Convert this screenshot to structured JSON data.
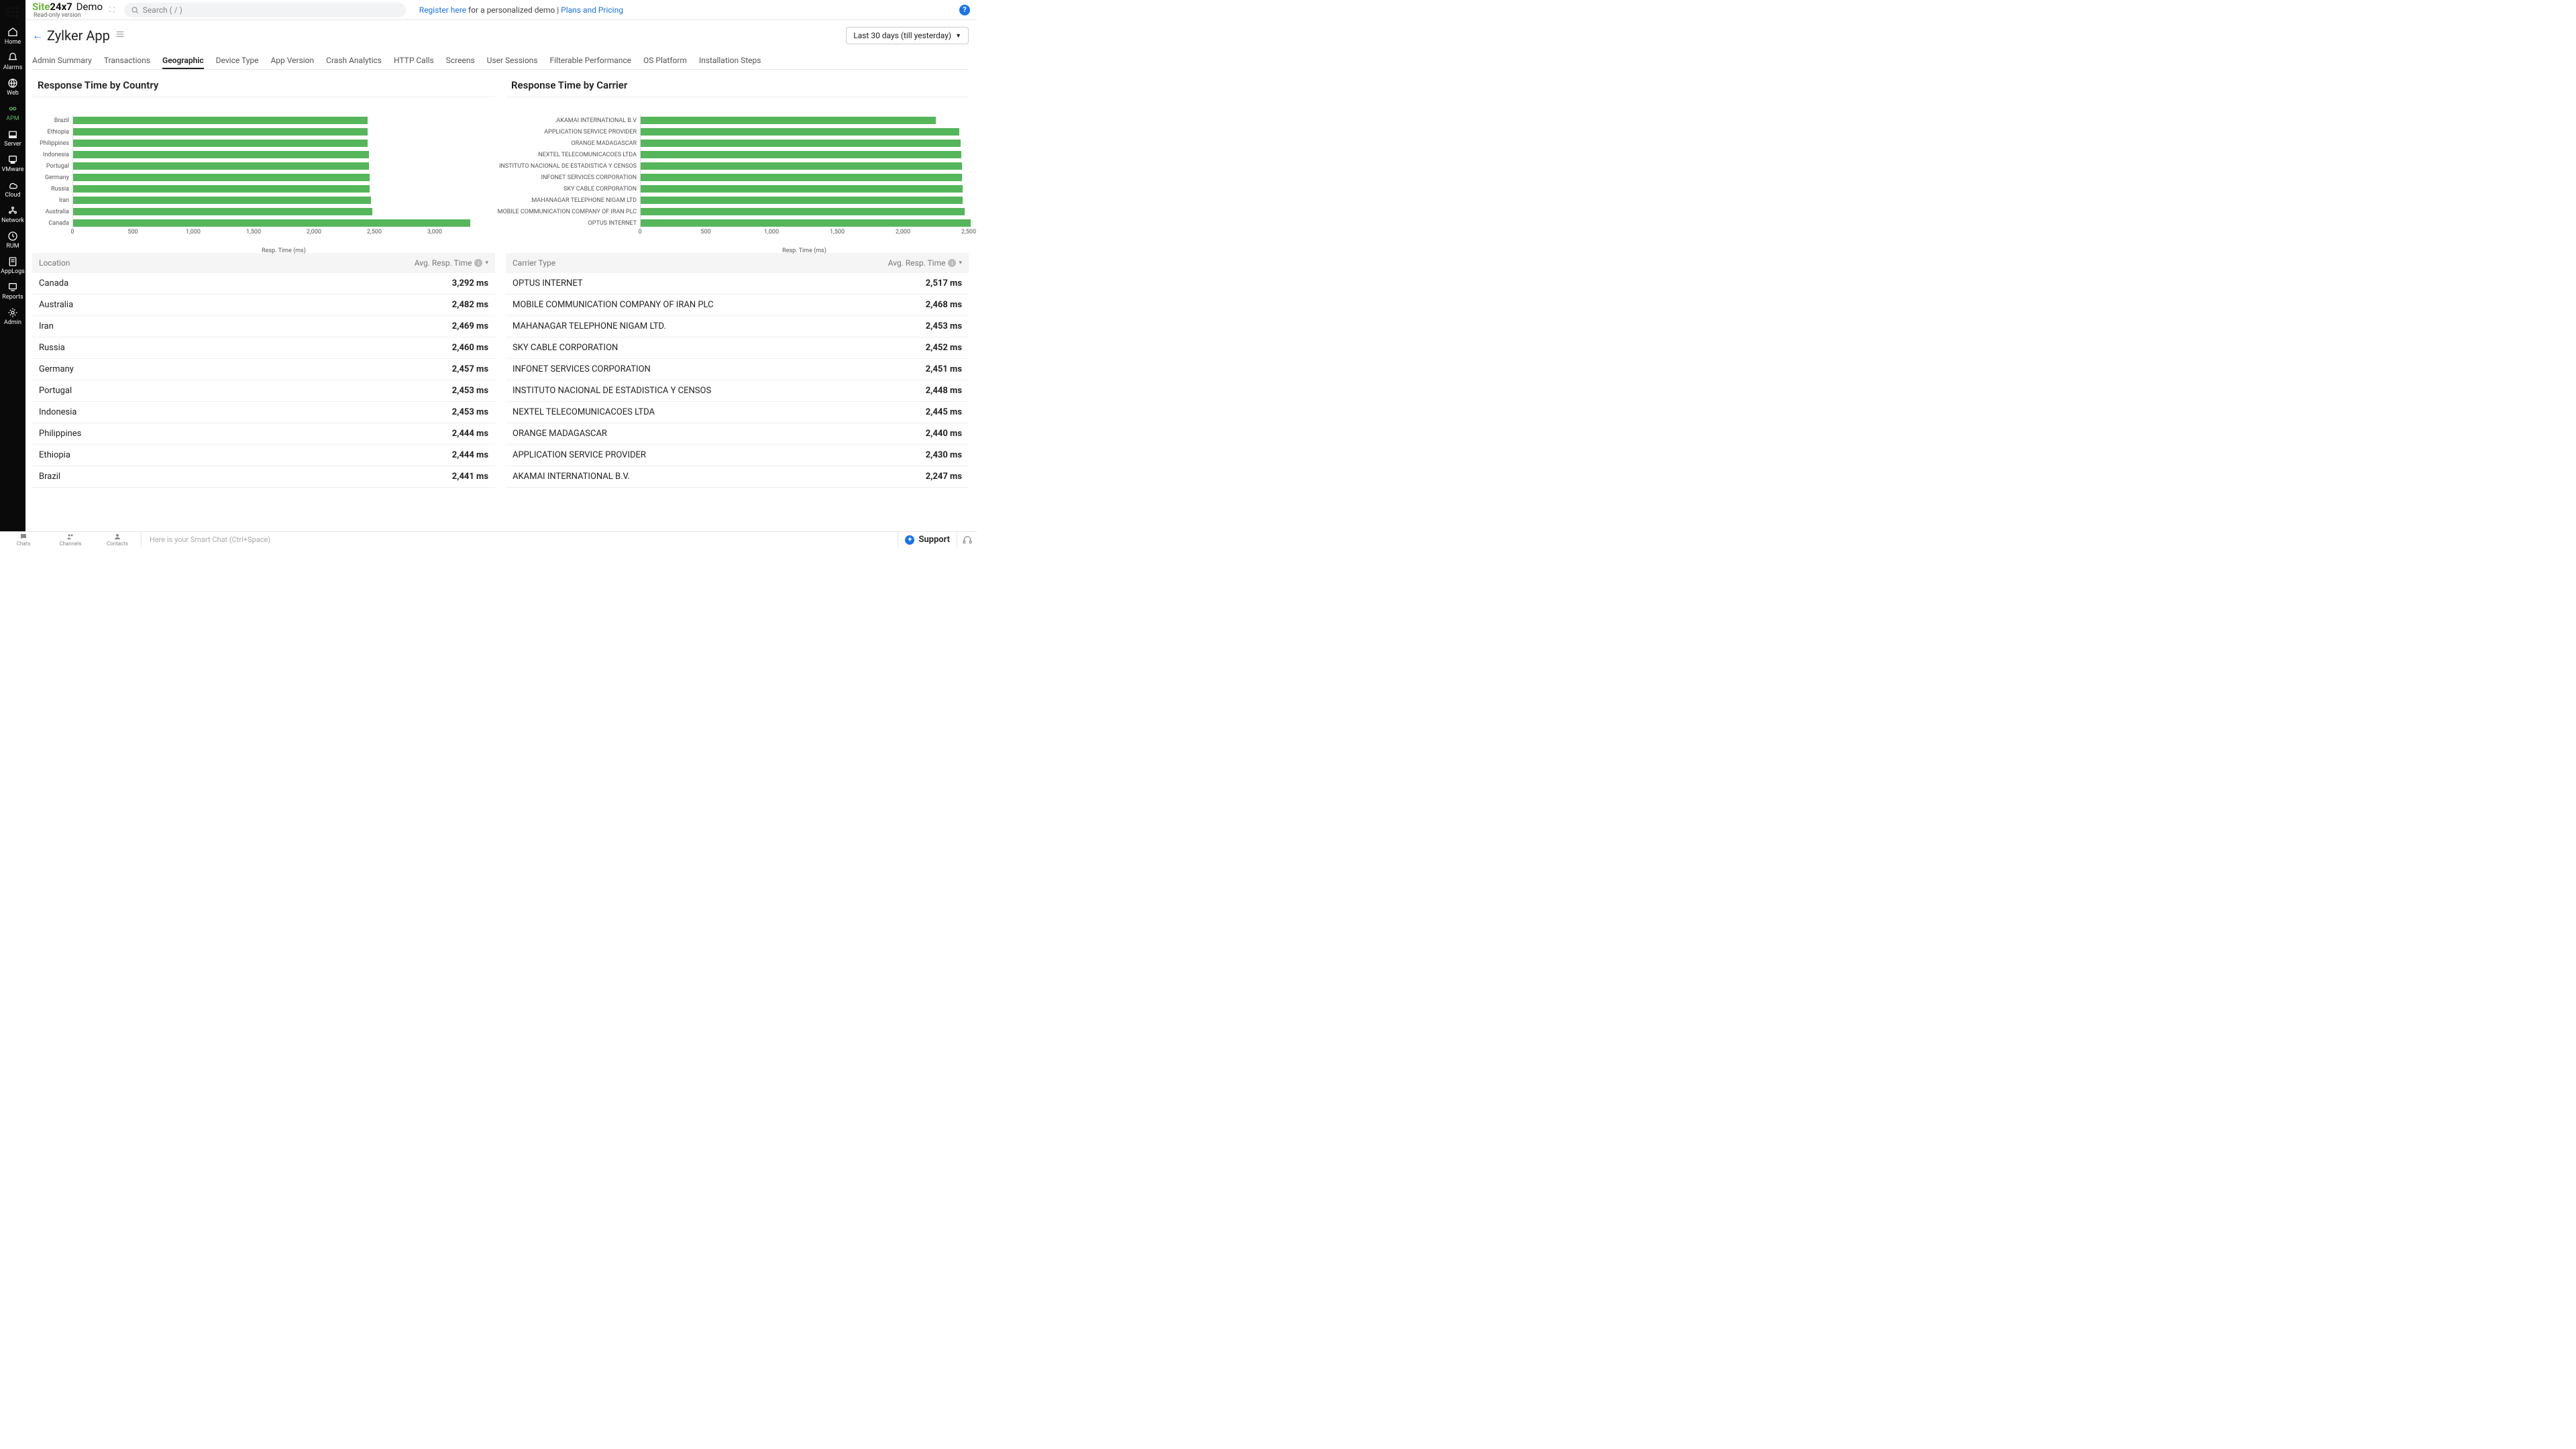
{
  "logo": {
    "site": "Site",
    "twofourseven": "24x7",
    "demo": "Demo",
    "readonly": "Read-only version"
  },
  "search": {
    "placeholder": "Search ( / )"
  },
  "top_links": {
    "register": "Register here",
    "register_tail": " for a personalized demo | ",
    "plans": "Plans and Pricing"
  },
  "sidebar": {
    "items": [
      {
        "label": "Home"
      },
      {
        "label": "Alarms"
      },
      {
        "label": "Web"
      },
      {
        "label": "APM"
      },
      {
        "label": "Server"
      },
      {
        "label": "VMware"
      },
      {
        "label": "Cloud"
      },
      {
        "label": "Network"
      },
      {
        "label": "RUM"
      },
      {
        "label": "AppLogs"
      },
      {
        "label": "Reports"
      },
      {
        "label": "Admin"
      }
    ]
  },
  "page": {
    "title": "Zylker App",
    "date_range": "Last 30 days (till yesterday)"
  },
  "tabs": [
    "Admin Summary",
    "Transactions",
    "Geographic",
    "Device Type",
    "App Version",
    "Crash Analytics",
    "HTTP Calls",
    "Screens",
    "User Sessions",
    "Filterable Performance",
    "OS Platform",
    "Installation Steps"
  ],
  "active_tab": 2,
  "left_panel": {
    "title": "Response Time by Country",
    "table_header_left": "Location",
    "table_header_right": "Avg. Resp. Time"
  },
  "right_panel": {
    "title": "Response Time by Carrier",
    "table_header_left": "Carrier Type",
    "table_header_right": "Avg. Resp. Time"
  },
  "chart_data": [
    {
      "type": "bar",
      "orientation": "horizontal",
      "title": "Response Time by Country",
      "categories": [
        "Brazil",
        "Ethiopia",
        "Philippines",
        "Indonesia",
        "Portugal",
        "Germany",
        "Russia",
        "Iran",
        "Australia",
        "Canada"
      ],
      "values": [
        2441,
        2444,
        2444,
        2453,
        2453,
        2457,
        2460,
        2469,
        2482,
        3292
      ],
      "xlabel": "Resp. Time (ms)",
      "xlim": [
        0,
        3500
      ],
      "xticks": [
        0,
        500,
        1000,
        1500,
        2000,
        2500,
        3000
      ],
      "bar_color": "#55b65c"
    },
    {
      "type": "bar",
      "orientation": "horizontal",
      "title": "Response Time by Carrier",
      "categories": [
        "AKAMAI INTERNATIONAL B.V.",
        "APPLICATION SERVICE PROVIDER",
        "ORANGE MADAGASCAR",
        "NEXTEL TELECOMUNICACOES LTDA",
        "INSTITUTO NACIONAL DE ESTADISTICA Y CENSOS",
        "INFONET SERVICES CORPORATION",
        "SKY CABLE CORPORATION",
        "MAHANAGAR TELEPHONE NIGAM LTD.",
        "MOBILE COMMUNICATION COMPANY OF IRAN PLC",
        "OPTUS INTERNET"
      ],
      "values": [
        2247,
        2430,
        2440,
        2445,
        2448,
        2451,
        2452,
        2453,
        2468,
        2517
      ],
      "xlabel": "Resp. Time (ms)",
      "xlim": [
        0,
        2500
      ],
      "xticks": [
        0,
        500,
        1000,
        1500,
        2000,
        2500
      ],
      "bar_color": "#55b65c"
    }
  ],
  "tables": {
    "country": [
      {
        "name": "Canada",
        "value": "3,292 ms"
      },
      {
        "name": "Australia",
        "value": "2,482 ms"
      },
      {
        "name": "Iran",
        "value": "2,469 ms"
      },
      {
        "name": "Russia",
        "value": "2,460 ms"
      },
      {
        "name": "Germany",
        "value": "2,457 ms"
      },
      {
        "name": "Portugal",
        "value": "2,453 ms"
      },
      {
        "name": "Indonesia",
        "value": "2,453 ms"
      },
      {
        "name": "Philippines",
        "value": "2,444 ms"
      },
      {
        "name": "Ethiopia",
        "value": "2,444 ms"
      },
      {
        "name": "Brazil",
        "value": "2,441 ms"
      }
    ],
    "carrier": [
      {
        "name": "OPTUS INTERNET",
        "value": "2,517 ms"
      },
      {
        "name": "MOBILE COMMUNICATION COMPANY OF IRAN PLC",
        "value": "2,468 ms"
      },
      {
        "name": "MAHANAGAR TELEPHONE NIGAM LTD.",
        "value": "2,453 ms"
      },
      {
        "name": "SKY CABLE CORPORATION",
        "value": "2,452 ms"
      },
      {
        "name": "INFONET SERVICES CORPORATION",
        "value": "2,451 ms"
      },
      {
        "name": "INSTITUTO NACIONAL DE ESTADISTICA Y CENSOS",
        "value": "2,448 ms"
      },
      {
        "name": "NEXTEL TELECOMUNICACOES LTDA",
        "value": "2,445 ms"
      },
      {
        "name": "ORANGE MADAGASCAR",
        "value": "2,440 ms"
      },
      {
        "name": "APPLICATION SERVICE PROVIDER",
        "value": "2,430 ms"
      },
      {
        "name": "AKAMAI INTERNATIONAL B.V.",
        "value": "2,247 ms"
      }
    ]
  },
  "bottom": {
    "chats": "Chats",
    "channels": "Channels",
    "contacts": "Contacts",
    "smart_chat": "Here is your Smart Chat (Ctrl+Space)",
    "support": "Support"
  }
}
